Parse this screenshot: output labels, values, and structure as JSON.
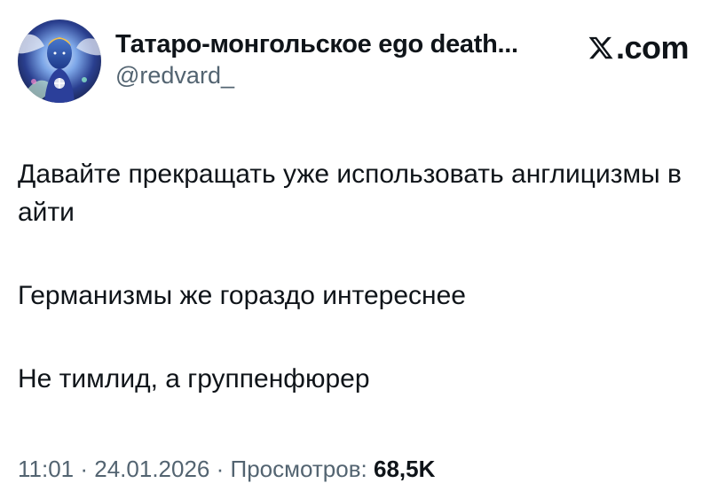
{
  "author": {
    "display_name": "Татаро-монгольское ego death...",
    "handle": "@redvard_"
  },
  "brand": {
    "icon": "x-logo-icon",
    "text": ".com"
  },
  "tweet": {
    "paragraphs": [
      "Давайте прекращать уже использовать англицизмы в айти",
      "Германизмы же гораздо интереснее",
      "Не тимлид, а группенфюрер"
    ]
  },
  "meta": {
    "time": "11:01",
    "separator": " · ",
    "date": "24.01.2026",
    "views_label": "Просмотров:",
    "views_count": "68,5K"
  },
  "colors": {
    "text_primary": "#0f1419",
    "text_secondary": "#536471",
    "avatar_bg": "#1a2a6c"
  }
}
